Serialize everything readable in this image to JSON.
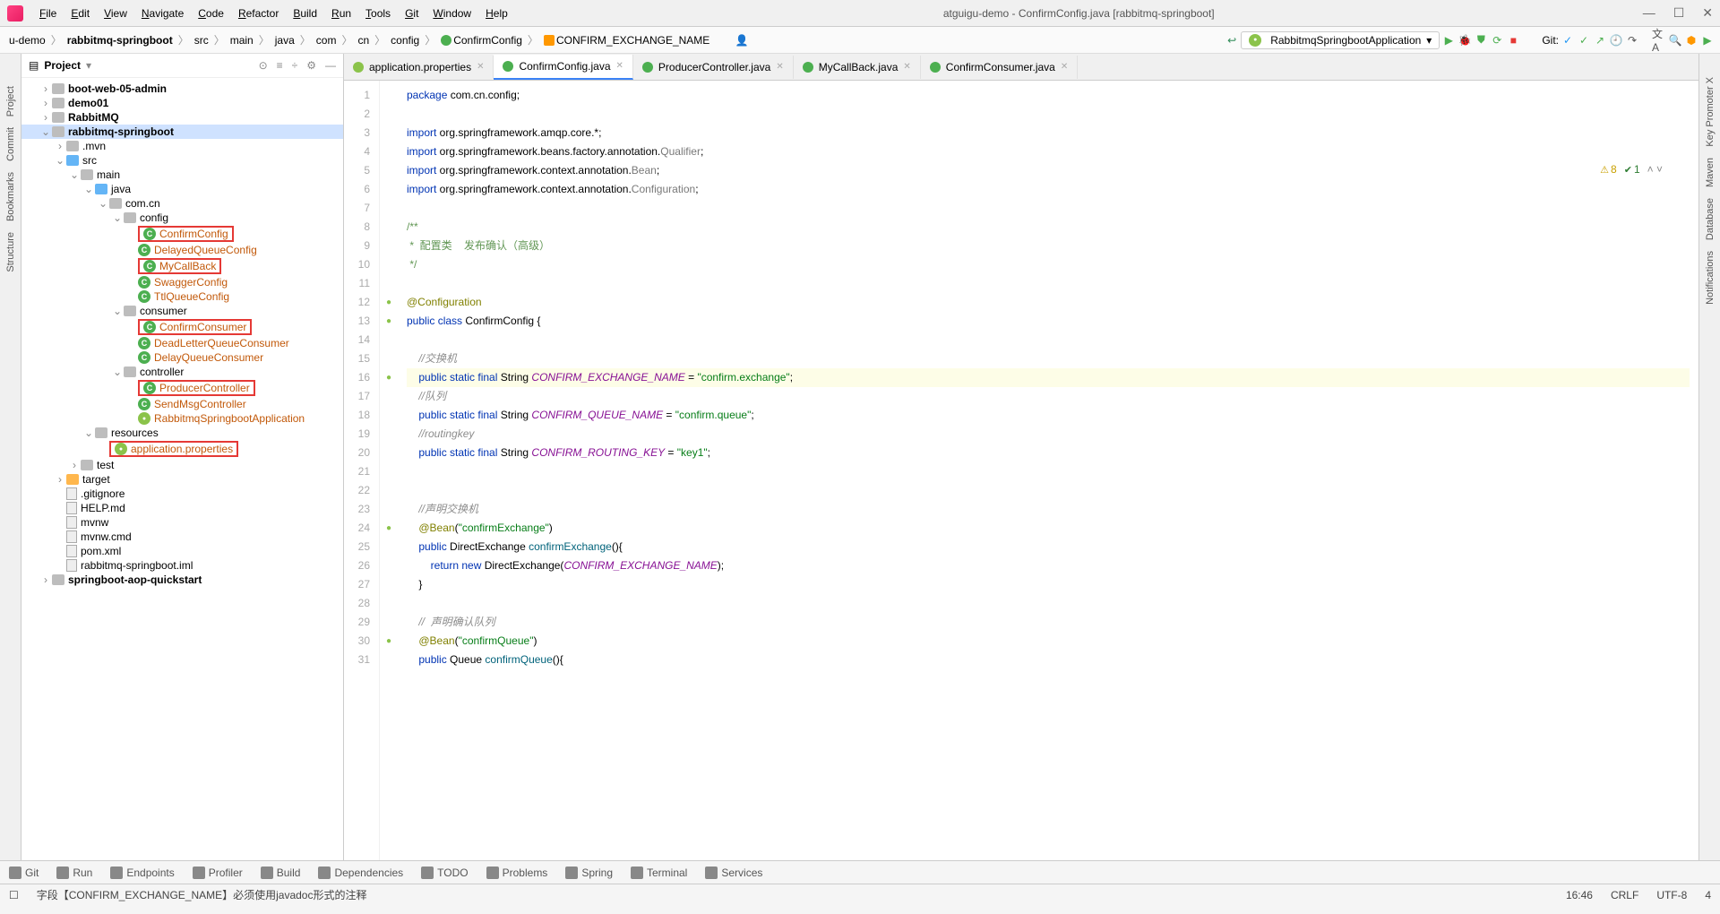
{
  "menus": [
    "File",
    "Edit",
    "View",
    "Navigate",
    "Code",
    "Refactor",
    "Build",
    "Run",
    "Tools",
    "Git",
    "Window",
    "Help"
  ],
  "window_title": "atguigu-demo - ConfirmConfig.java [rabbitmq-springboot]",
  "breadcrumb": {
    "parts": [
      "u-demo",
      "rabbitmq-springboot",
      "src",
      "main",
      "java",
      "com",
      "cn",
      "config",
      "ConfirmConfig",
      "CONFIRM_EXCHANGE_NAME"
    ]
  },
  "run_config": "RabbitmqSpringbootApplication",
  "git_label": "Git:",
  "project": {
    "panel_title": "Project",
    "tree": [
      {
        "indent": 1,
        "chev": ">",
        "icon": "folder",
        "label": "boot-web-05-admin",
        "bold": true
      },
      {
        "indent": 1,
        "chev": ">",
        "icon": "folder",
        "label": "demo01",
        "bold": true
      },
      {
        "indent": 1,
        "chev": ">",
        "icon": "folder",
        "label": "RabbitMQ",
        "bold": true
      },
      {
        "indent": 1,
        "chev": "v",
        "icon": "folder",
        "label": "rabbitmq-springboot",
        "bold": true,
        "selected": true
      },
      {
        "indent": 2,
        "chev": ">",
        "icon": "folder",
        "label": ".mvn"
      },
      {
        "indent": 2,
        "chev": "v",
        "icon": "folder-blue",
        "label": "src"
      },
      {
        "indent": 3,
        "chev": "v",
        "icon": "folder",
        "label": "main"
      },
      {
        "indent": 4,
        "chev": "v",
        "icon": "folder-blue",
        "label": "java"
      },
      {
        "indent": 5,
        "chev": "v",
        "icon": "folder",
        "label": "com.cn"
      },
      {
        "indent": 6,
        "chev": "v",
        "icon": "folder",
        "label": "config"
      },
      {
        "indent": 7,
        "chev": "",
        "icon": "class",
        "label": "ConfirmConfig",
        "red": true,
        "orange": true
      },
      {
        "indent": 7,
        "chev": "",
        "icon": "class",
        "label": "DelayedQueueConfig",
        "orange": true
      },
      {
        "indent": 7,
        "chev": "",
        "icon": "class",
        "label": "MyCallBack",
        "red": true,
        "orange": true
      },
      {
        "indent": 7,
        "chev": "",
        "icon": "class",
        "label": "SwaggerConfig",
        "orange": true
      },
      {
        "indent": 7,
        "chev": "",
        "icon": "class",
        "label": "TtlQueueConfig",
        "orange": true
      },
      {
        "indent": 6,
        "chev": "v",
        "icon": "folder",
        "label": "consumer"
      },
      {
        "indent": 7,
        "chev": "",
        "icon": "class",
        "label": "ConfirmConsumer",
        "red": true,
        "orange": true
      },
      {
        "indent": 7,
        "chev": "",
        "icon": "class",
        "label": "DeadLetterQueueConsumer",
        "orange": true
      },
      {
        "indent": 7,
        "chev": "",
        "icon": "class",
        "label": "DelayQueueConsumer",
        "orange": true
      },
      {
        "indent": 6,
        "chev": "v",
        "icon": "folder",
        "label": "controller"
      },
      {
        "indent": 7,
        "chev": "",
        "icon": "class",
        "label": "ProducerController",
        "red": true,
        "orange": true
      },
      {
        "indent": 7,
        "chev": "",
        "icon": "class",
        "label": "SendMsgController",
        "orange": true
      },
      {
        "indent": 7,
        "chev": "",
        "icon": "leaf",
        "label": "RabbitmqSpringbootApplication",
        "orange": true
      },
      {
        "indent": 4,
        "chev": "v",
        "icon": "folder",
        "label": "resources"
      },
      {
        "indent": 5,
        "chev": "",
        "icon": "leaf",
        "label": "application.properties",
        "red": true,
        "orange": true
      },
      {
        "indent": 3,
        "chev": ">",
        "icon": "folder",
        "label": "test"
      },
      {
        "indent": 2,
        "chev": ">",
        "icon": "folder-orange",
        "label": "target"
      },
      {
        "indent": 2,
        "chev": "",
        "icon": "file",
        "label": ".gitignore"
      },
      {
        "indent": 2,
        "chev": "",
        "icon": "file",
        "label": "HELP.md"
      },
      {
        "indent": 2,
        "chev": "",
        "icon": "file",
        "label": "mvnw"
      },
      {
        "indent": 2,
        "chev": "",
        "icon": "file",
        "label": "mvnw.cmd"
      },
      {
        "indent": 2,
        "chev": "",
        "icon": "file",
        "label": "pom.xml"
      },
      {
        "indent": 2,
        "chev": "",
        "icon": "file",
        "label": "rabbitmq-springboot.iml"
      },
      {
        "indent": 1,
        "chev": ">",
        "icon": "folder",
        "label": "springboot-aop-quickstart",
        "bold": true
      }
    ]
  },
  "tabs": [
    {
      "label": "application.properties",
      "icon": "leaf"
    },
    {
      "label": "ConfirmConfig.java",
      "icon": "green",
      "active": true
    },
    {
      "label": "ProducerController.java",
      "icon": "green"
    },
    {
      "label": "MyCallBack.java",
      "icon": "green"
    },
    {
      "label": "ConfirmConsumer.java",
      "icon": "green"
    }
  ],
  "inspection": {
    "warn": "8",
    "ok": "1"
  },
  "code_lines": [
    1,
    2,
    3,
    4,
    5,
    6,
    7,
    8,
    9,
    10,
    11,
    12,
    13,
    14,
    15,
    16,
    17,
    18,
    19,
    20,
    21,
    22,
    23,
    24,
    25,
    26,
    27,
    28,
    29,
    30,
    31
  ],
  "code": {
    "l1": {
      "pkg": "package",
      "path": "com.cn.config"
    },
    "l3": {
      "imp": "import",
      "path": "org.springframework.amqp.core.*"
    },
    "l4": {
      "imp": "import",
      "path": "org.springframework.beans.factory.annotation.",
      "cls": "Qualifier"
    },
    "l5": {
      "imp": "import",
      "path": "org.springframework.context.annotation.",
      "cls": "Bean"
    },
    "l6": {
      "imp": "import",
      "path": "org.springframework.context.annotation.",
      "cls": "Configuration"
    },
    "l8": "/**",
    "l9": " *  配置类    发布确认（高级）",
    "l10": " */",
    "l12": "@Configuration",
    "l13": {
      "kw1": "public",
      "kw2": "class",
      "name": "ConfirmConfig",
      "brace": "{"
    },
    "l15": "//交换机",
    "l16": {
      "mods": "public static final",
      "type": "String",
      "name": "CONFIRM_EXCHANGE_NAME",
      "eq": " = ",
      "val": "\"confirm.exchange\"",
      ";": ";"
    },
    "l17": "//队列",
    "l18": {
      "mods": "public static final",
      "type": "String",
      "name": "CONFIRM_QUEUE_NAME",
      "eq": " = ",
      "val": "\"confirm.queue\"",
      ";": ";"
    },
    "l19": "//routingkey",
    "l20": {
      "mods": "public static final",
      "type": "String",
      "name": "CONFIRM_ROUTING_KEY",
      "eq": " = ",
      "val": "\"key1\"",
      ";": ";"
    },
    "l23": "//声明交换机",
    "l24": {
      "ann": "@Bean",
      "arg": "\"confirmExchange\""
    },
    "l25": {
      "mods": "public",
      "type": "DirectExchange",
      "name": "confirmExchange",
      "sig": "(){"
    },
    "l26": {
      "ret": "return",
      "new": "new",
      "type": "DirectExchange",
      "arg": "CONFIRM_EXCHANGE_NAME",
      ";": ");"
    },
    "l27": "}",
    "l29": "//  声明确认队列",
    "l30": {
      "ann": "@Bean",
      "arg": "\"confirmQueue\""
    },
    "l31": {
      "mods": "public",
      "type": "Queue",
      "name": "confirmQueue",
      "sig": "(){"
    }
  },
  "left_tools": [
    "Project",
    "Commit",
    "Bookmarks",
    "Structure"
  ],
  "right_tools": [
    "Key Promoter X",
    "Maven",
    "Database",
    "Notifications"
  ],
  "bottom_tools": [
    "Git",
    "Run",
    "Endpoints",
    "Profiler",
    "Build",
    "Dependencies",
    "TODO",
    "Problems",
    "Spring",
    "Terminal",
    "Services"
  ],
  "status": {
    "msg": "字段【CONFIRM_EXCHANGE_NAME】必须使用javadoc形式的注释",
    "pos": "16:46",
    "sep": "CRLF",
    "enc": "UTF-8",
    "indent": "4"
  }
}
